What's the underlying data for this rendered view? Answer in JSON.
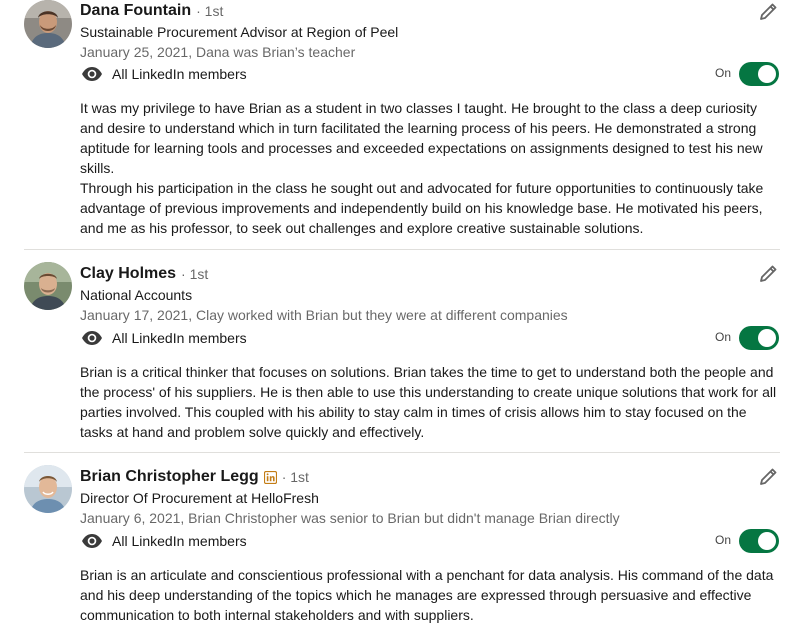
{
  "colors": {
    "toggle_on": "#057642",
    "linkedin_badge": "#c37d16",
    "divider": "#e0dfdc"
  },
  "recommendations": [
    {
      "name": "Dana Fountain",
      "degree": "· 1st",
      "headline": "Sustainable Procurement Advisor at Region of Peel",
      "meta": "January 25, 2021, Dana was Brian’s teacher",
      "visibility": "All LinkedIn members",
      "visibility_icon": "eye-icon",
      "toggle_label": "On",
      "toggle_state": true,
      "body": [
        "It was my privilege to have Brian as a student in two classes I taught. He brought to the class a deep curiosity and desire to understand which in turn facilitated the learning process of his peers. He demonstrated a strong aptitude for learning tools and processes and exceeded expectations on assignments designed to test his new skills.",
        "Through his participation in the class he sought out and advocated for future opportunities to continuously take advantage of previous improvements and independently build on his knowledge base. He motivated his peers, and me as his professor, to seek out challenges and explore creative sustainable solutions."
      ]
    },
    {
      "name": "Clay Holmes",
      "degree": "· 1st",
      "headline": "National Accounts",
      "meta": "January 17, 2021, Clay worked with Brian but they were at different companies",
      "visibility": "All LinkedIn members",
      "visibility_icon": "eye-icon",
      "toggle_label": "On",
      "toggle_state": true,
      "body": [
        "Brian is a critical thinker that focuses on solutions. Brian takes the time to get to understand both the people and the process' of his suppliers. He is then able to use this understanding to create unique solutions that work for all parties involved. This coupled with his ability to stay calm in times of crisis allows him to stay focused on the tasks at hand and problem solve quickly and effectively."
      ]
    },
    {
      "name": "Brian Christopher Legg",
      "linkedin_badge_icon": "linkedin-badge-icon",
      "degree": "· 1st",
      "headline": "Director Of Procurement at HelloFresh",
      "meta": "January 6, 2021, Brian Christopher was senior to Brian but didn't manage Brian directly",
      "visibility": "All LinkedIn members",
      "visibility_icon": "eye-icon",
      "toggle_label": "On",
      "toggle_state": true,
      "body": [
        "Brian is an articulate and conscientious professional with a penchant for data analysis. His command of the data and his deep understanding of the topics which he manages are expressed through persuasive and effective communication to both internal stakeholders and with suppliers."
      ]
    }
  ]
}
